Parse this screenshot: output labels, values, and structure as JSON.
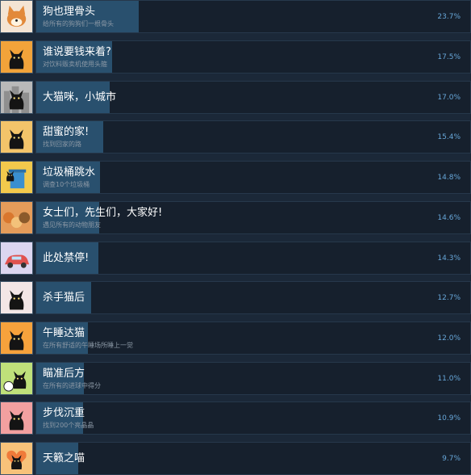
{
  "achievements": [
    {
      "title": "狗也理骨头",
      "desc": "给所有的狗狗们一根骨头",
      "percent_label": "23.7%",
      "percent": 23.7,
      "icon": "shiba-dog-icon",
      "icon_bg": "#f4e4d4"
    },
    {
      "title": "谁说要钱来着?",
      "desc": "对饮料贩卖机使用头箍",
      "percent_label": "17.5%",
      "percent": 17.5,
      "icon": "cat-vending-icon",
      "icon_bg": "#f2a33a"
    },
    {
      "title": "大猫咪，小城市",
      "desc": "",
      "percent_label": "17.0%",
      "percent": 17.0,
      "icon": "cat-city-icon",
      "icon_bg": "#b9b9b9"
    },
    {
      "title": "甜蜜的家!",
      "desc": "找到回家的路",
      "percent_label": "15.4%",
      "percent": 15.4,
      "icon": "cat-home-icon",
      "icon_bg": "#f3c46a"
    },
    {
      "title": "垃圾桶跳水",
      "desc": "调查10个垃圾桶",
      "percent_label": "14.8%",
      "percent": 14.8,
      "icon": "trash-bin-icon",
      "icon_bg": "#f2c94c"
    },
    {
      "title": "女士们，先生们，大家好!",
      "desc": "遇见所有的动物朋友",
      "percent_label": "14.6%",
      "percent": 14.6,
      "icon": "animal-friends-icon",
      "icon_bg": "#e59c5a"
    },
    {
      "title": "此处禁停!",
      "desc": "",
      "percent_label": "14.3%",
      "percent": 14.3,
      "icon": "car-icon",
      "icon_bg": "#dcd6f0"
    },
    {
      "title": "杀手猫后",
      "desc": "",
      "percent_label": "12.7%",
      "percent": 12.7,
      "icon": "cat-killer-icon",
      "icon_bg": "#f3e6e6"
    },
    {
      "title": "午睡达猫",
      "desc": "在所有舒适的午睡场所睡上一觉",
      "percent_label": "12.0%",
      "percent": 12.0,
      "icon": "cat-nap-icon",
      "icon_bg": "#f6a23c"
    },
    {
      "title": "瞄准后方",
      "desc": "在所有的进球中得分",
      "percent_label": "11.0%",
      "percent": 11.0,
      "icon": "cat-soccer-icon",
      "icon_bg": "#bfe07a"
    },
    {
      "title": "步伐沉重",
      "desc": "找到200个亮晶晶",
      "percent_label": "10.9%",
      "percent": 10.9,
      "icon": "cat-shine-icon",
      "icon_bg": "#f2a0a0"
    },
    {
      "title": "天籁之喵",
      "desc": "",
      "percent_label": "9.7%",
      "percent": 9.7,
      "icon": "cat-heart-icon",
      "icon_bg": "#f7c27a"
    }
  ],
  "colors": {
    "background": "#1b2838",
    "bar_track": "#16202d",
    "bar_fill": "#29506e",
    "title": "#ffffff",
    "desc": "#8b98a5",
    "percent": "#67a6d8"
  }
}
